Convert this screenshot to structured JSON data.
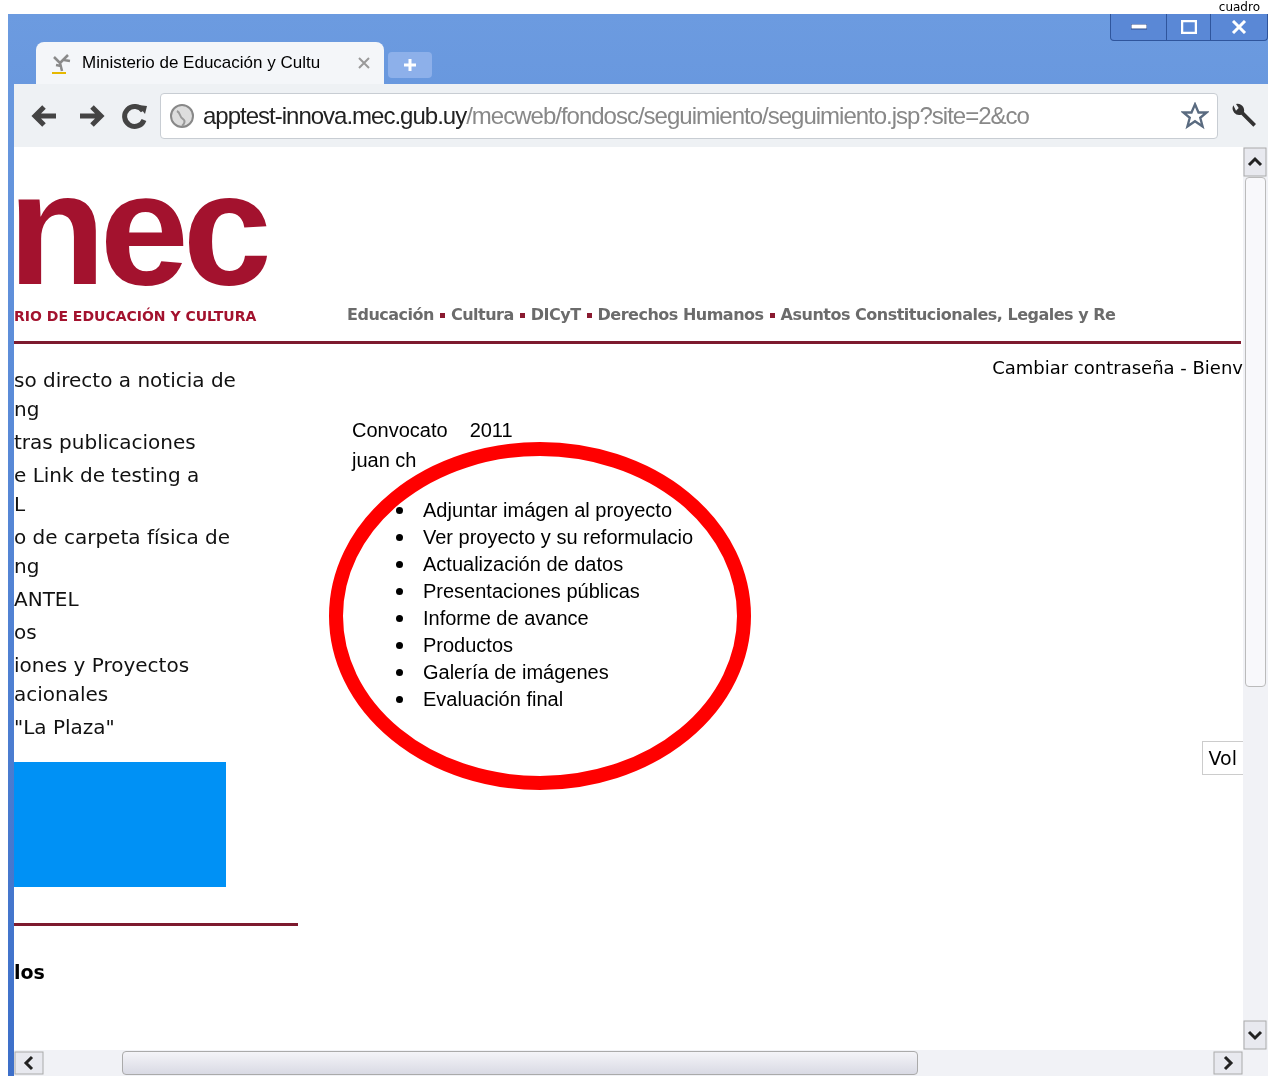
{
  "corner_text": "cuadro",
  "tabs": [
    {
      "title": "Ministerio de Educación y Cultu",
      "selected": true
    }
  ],
  "address_bar": {
    "host": "apptest-innova.mec.gub.uy",
    "path": "/mecweb/fondosc/seguimiento/seguimiento.jsp?site=2&co"
  },
  "header": {
    "logo": "nec",
    "logo_subtitle": "RIO DE EDUCACIÓN Y CULTURA",
    "nav": [
      "Educación",
      "Cultura",
      "DICyT",
      "Derechos Humanos",
      "Asuntos Constitucionales, Legales y Re"
    ]
  },
  "user_bar": "Cambiar contraseña - Bienv",
  "sidebar": {
    "links": [
      {
        "lines": [
          "so directo a noticia de",
          "ng"
        ]
      },
      {
        "lines": [
          "tras publicaciones"
        ]
      },
      {
        "lines": [
          "e Link de testing a",
          "L"
        ]
      },
      {
        "lines": [
          "o de carpeta física de",
          "ng"
        ]
      },
      {
        "lines": [
          "ANTEL"
        ]
      },
      {
        "lines": [
          "os"
        ]
      },
      {
        "lines": [
          "iones y Proyectos",
          "acionales"
        ]
      },
      {
        "lines": [
          "\"La Plaza\""
        ]
      }
    ],
    "section_title": "los"
  },
  "main": {
    "convocatoria": [
      "Convocato",
      "2011"
    ],
    "user": "juan ch",
    "actions": [
      "Adjuntar imágen al proyecto",
      "Ver proyecto y su reformulacio",
      "Actualización de datos",
      "Presentaciones públicas",
      "Informe de avance",
      "Productos",
      "Galería de imágenes",
      "Evaluación final"
    ]
  },
  "back_button": "Vol"
}
